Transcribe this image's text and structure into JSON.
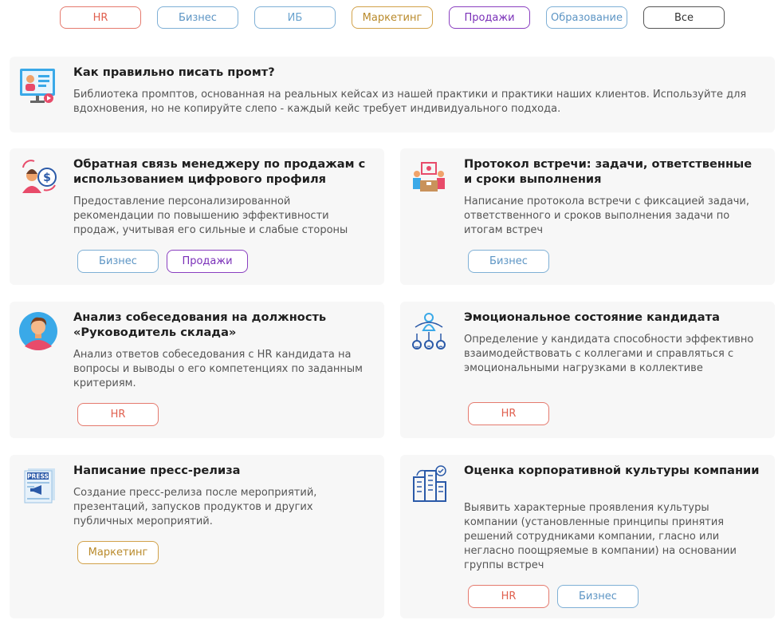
{
  "filters": [
    {
      "label": "HR",
      "color": "#e0604f"
    },
    {
      "label": "Бизнес",
      "color": "#5d95c4"
    },
    {
      "label": "ИБ",
      "color": "#6aa3cf"
    },
    {
      "label": "Маркетинг",
      "color": "#b98a2b"
    },
    {
      "label": "Продажи",
      "color": "#7a2fb8"
    },
    {
      "label": "Образование",
      "color": "#5d95c4"
    },
    {
      "label": "Все",
      "color": "#333333"
    }
  ],
  "intro": {
    "icon": "presentation-icon",
    "title": "Как правильно писать промт?",
    "description": "Библиотека промптов, основанная на реальных кейсах из нашей практики и практики наших клиентов. Используйте для вдохновения, но не копируйте слепо - каждый кейс требует индивидуального подхода."
  },
  "cards": [
    {
      "icon": "manager-dollar-icon",
      "title": "Обратная связь менеджеру по продажам с использованием цифрового профиля",
      "description": "Предоставление персонализированной рекомендации по повышению эффективности продаж, учитывая его сильные и слабые стороны",
      "tags": [
        "Бизнес",
        "Продажи"
      ]
    },
    {
      "icon": "meeting-icon",
      "title": "Протокол встречи: задачи, ответственные и сроки выполнения",
      "description": "Написание протокола встречи с фиксацией задачи, ответственного и сроков выполнения задачи по итогам встреч",
      "tags": [
        "Бизнес"
      ]
    },
    {
      "icon": "avatar-icon",
      "title": "Анализ собеседования на должность «Руководитель склада»",
      "description": "Анализ ответов собеседования с HR кандидата на вопросы и выводы о его компетенциях по заданным критериям.",
      "tags": [
        "HR"
      ]
    },
    {
      "icon": "emotion-icon",
      "title": "Эмоциональное состояние кандидата",
      "description": "Определение у кандидата способности эффективно взаимодействовать с коллегами и справляться с эмоциональными нагрузками в коллективе",
      "tags": [
        "HR"
      ]
    },
    {
      "icon": "press-icon",
      "title": "Написание пресс-релиза",
      "description": "Создание пресс-релиза после мероприятий, презентаций, запусков продуктов и других публичных мероприятий.",
      "tags": [
        "Маркетинг"
      ]
    },
    {
      "icon": "buildings-icon",
      "title": "Оценка корпоративной культуры компании",
      "description": "Выявить характерные проявления культуры компании (установленные принципы принятия решений сотрудниками компании, гласно или негласно поощряемые в компании) на основании группы встреч",
      "tags": [
        "HR",
        "Бизнес"
      ]
    }
  ]
}
